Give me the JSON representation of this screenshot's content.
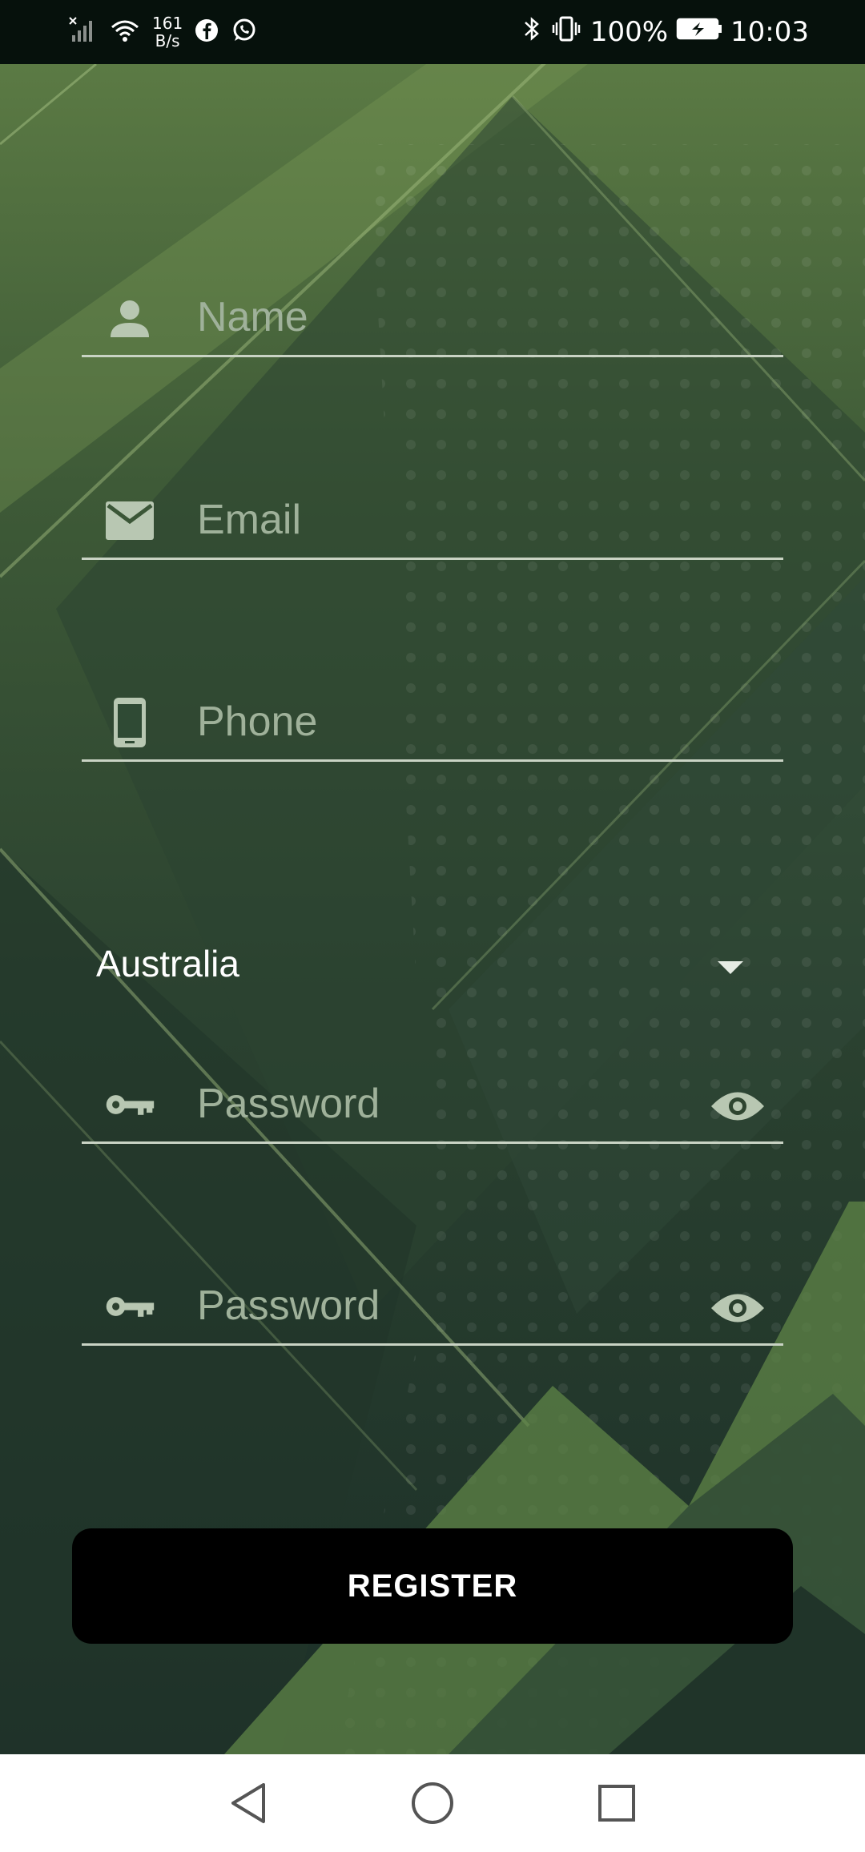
{
  "status_bar": {
    "net_speed_value": "161",
    "net_speed_unit": "B/s",
    "battery": "100%",
    "time": "10:03",
    "icons": [
      "signal-icon",
      "wifi-icon",
      "facebook-icon",
      "whatsapp-icon",
      "bluetooth-icon",
      "vibrate-icon",
      "battery-icon"
    ]
  },
  "form": {
    "name": {
      "placeholder": "Name",
      "value": "",
      "icon": "person-icon"
    },
    "email": {
      "placeholder": "Email",
      "value": "",
      "icon": "mail-icon"
    },
    "phone": {
      "placeholder": "Phone",
      "value": "",
      "icon": "phone-icon"
    },
    "country": {
      "selected": "Australia"
    },
    "password": {
      "placeholder": "Password",
      "value": "",
      "icon": "key-icon"
    },
    "confirm_password": {
      "placeholder": "Password",
      "value": "",
      "icon": "key-icon"
    },
    "register_label": "REGISTER"
  },
  "colors": {
    "bg_top": "#5b7a44",
    "bg_bottom": "#1c2f28",
    "field_line": "#c9d3c4",
    "placeholder": "#9fb19a",
    "button": "#000000"
  },
  "nav_bar": {
    "icons": [
      "back-icon",
      "home-icon",
      "recents-icon"
    ]
  }
}
